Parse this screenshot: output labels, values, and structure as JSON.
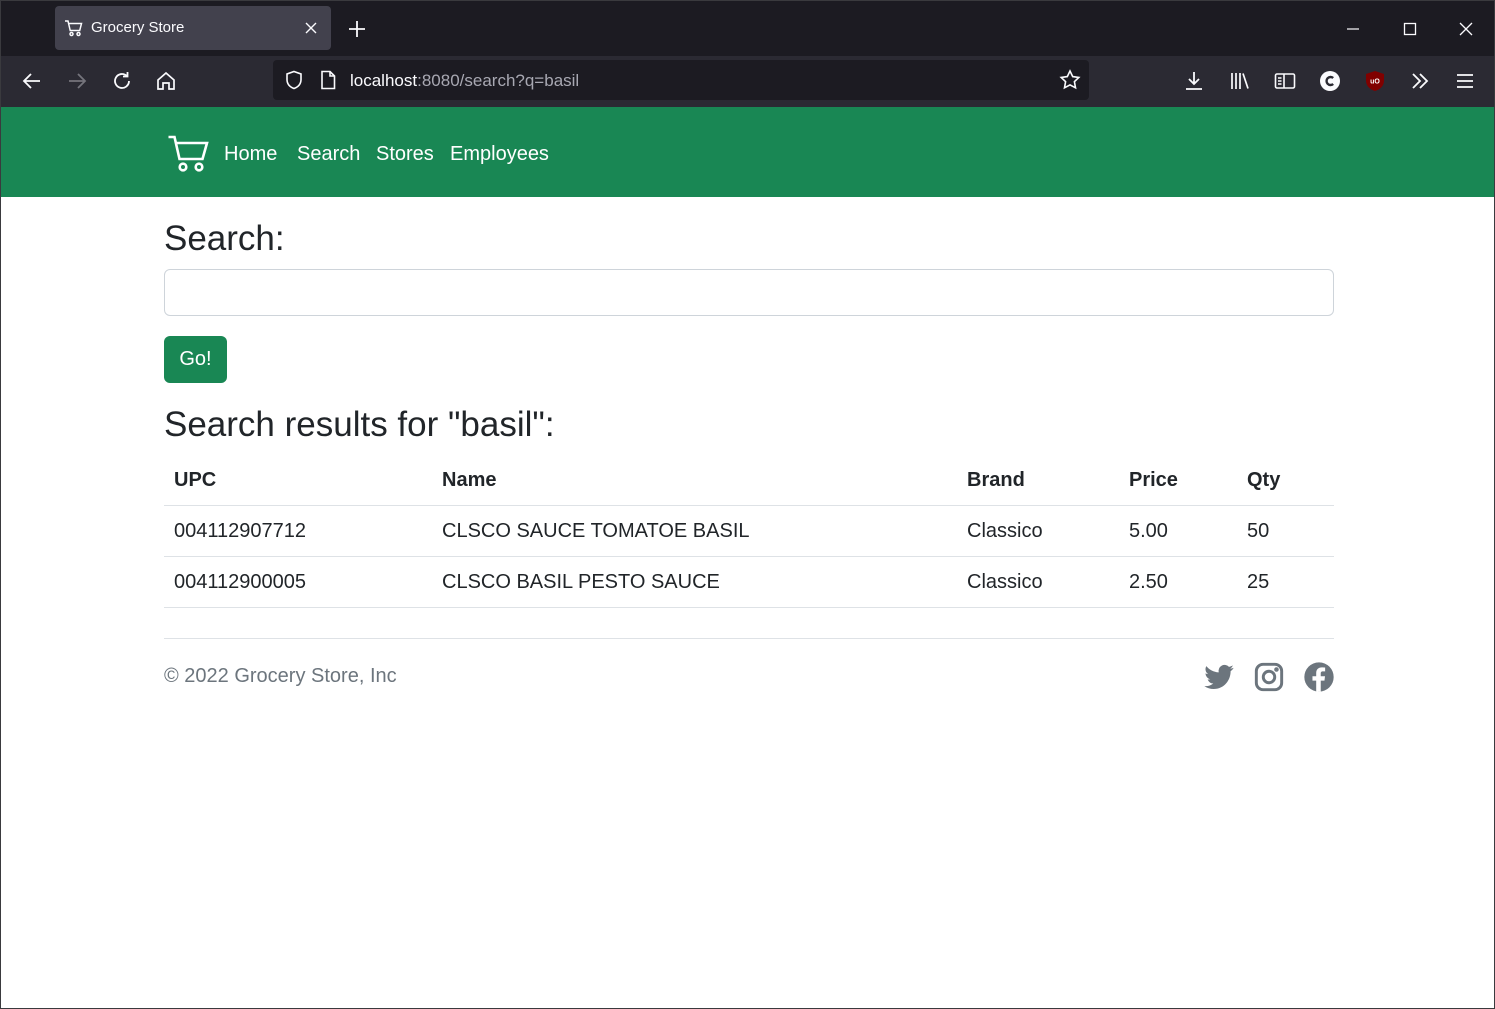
{
  "browser": {
    "tab_title": "Grocery Store",
    "url_host": "localhost",
    "url_rest": ":8080/search?q=basil"
  },
  "navbar": {
    "links": [
      "Home",
      "Search",
      "Stores",
      "Employees"
    ],
    "brand_color": "#198754"
  },
  "search": {
    "label": "Search:",
    "value": "",
    "placeholder": "",
    "button_label": "Go!"
  },
  "results": {
    "heading": "Search results for \"basil\":",
    "columns": [
      "UPC",
      "Name",
      "Brand",
      "Price",
      "Qty"
    ],
    "rows": [
      [
        "004112907712",
        "CLSCO SAUCE TOMATOE BASIL",
        "Classico",
        "5.00",
        "50"
      ],
      [
        "004112900005",
        "CLSCO BASIL PESTO SAUCE",
        "Classico",
        "2.50",
        "25"
      ]
    ]
  },
  "footer": {
    "copyright": "© 2022 Grocery Store, Inc",
    "social_icons": [
      "twitter-icon",
      "instagram-icon",
      "facebook-icon"
    ]
  }
}
